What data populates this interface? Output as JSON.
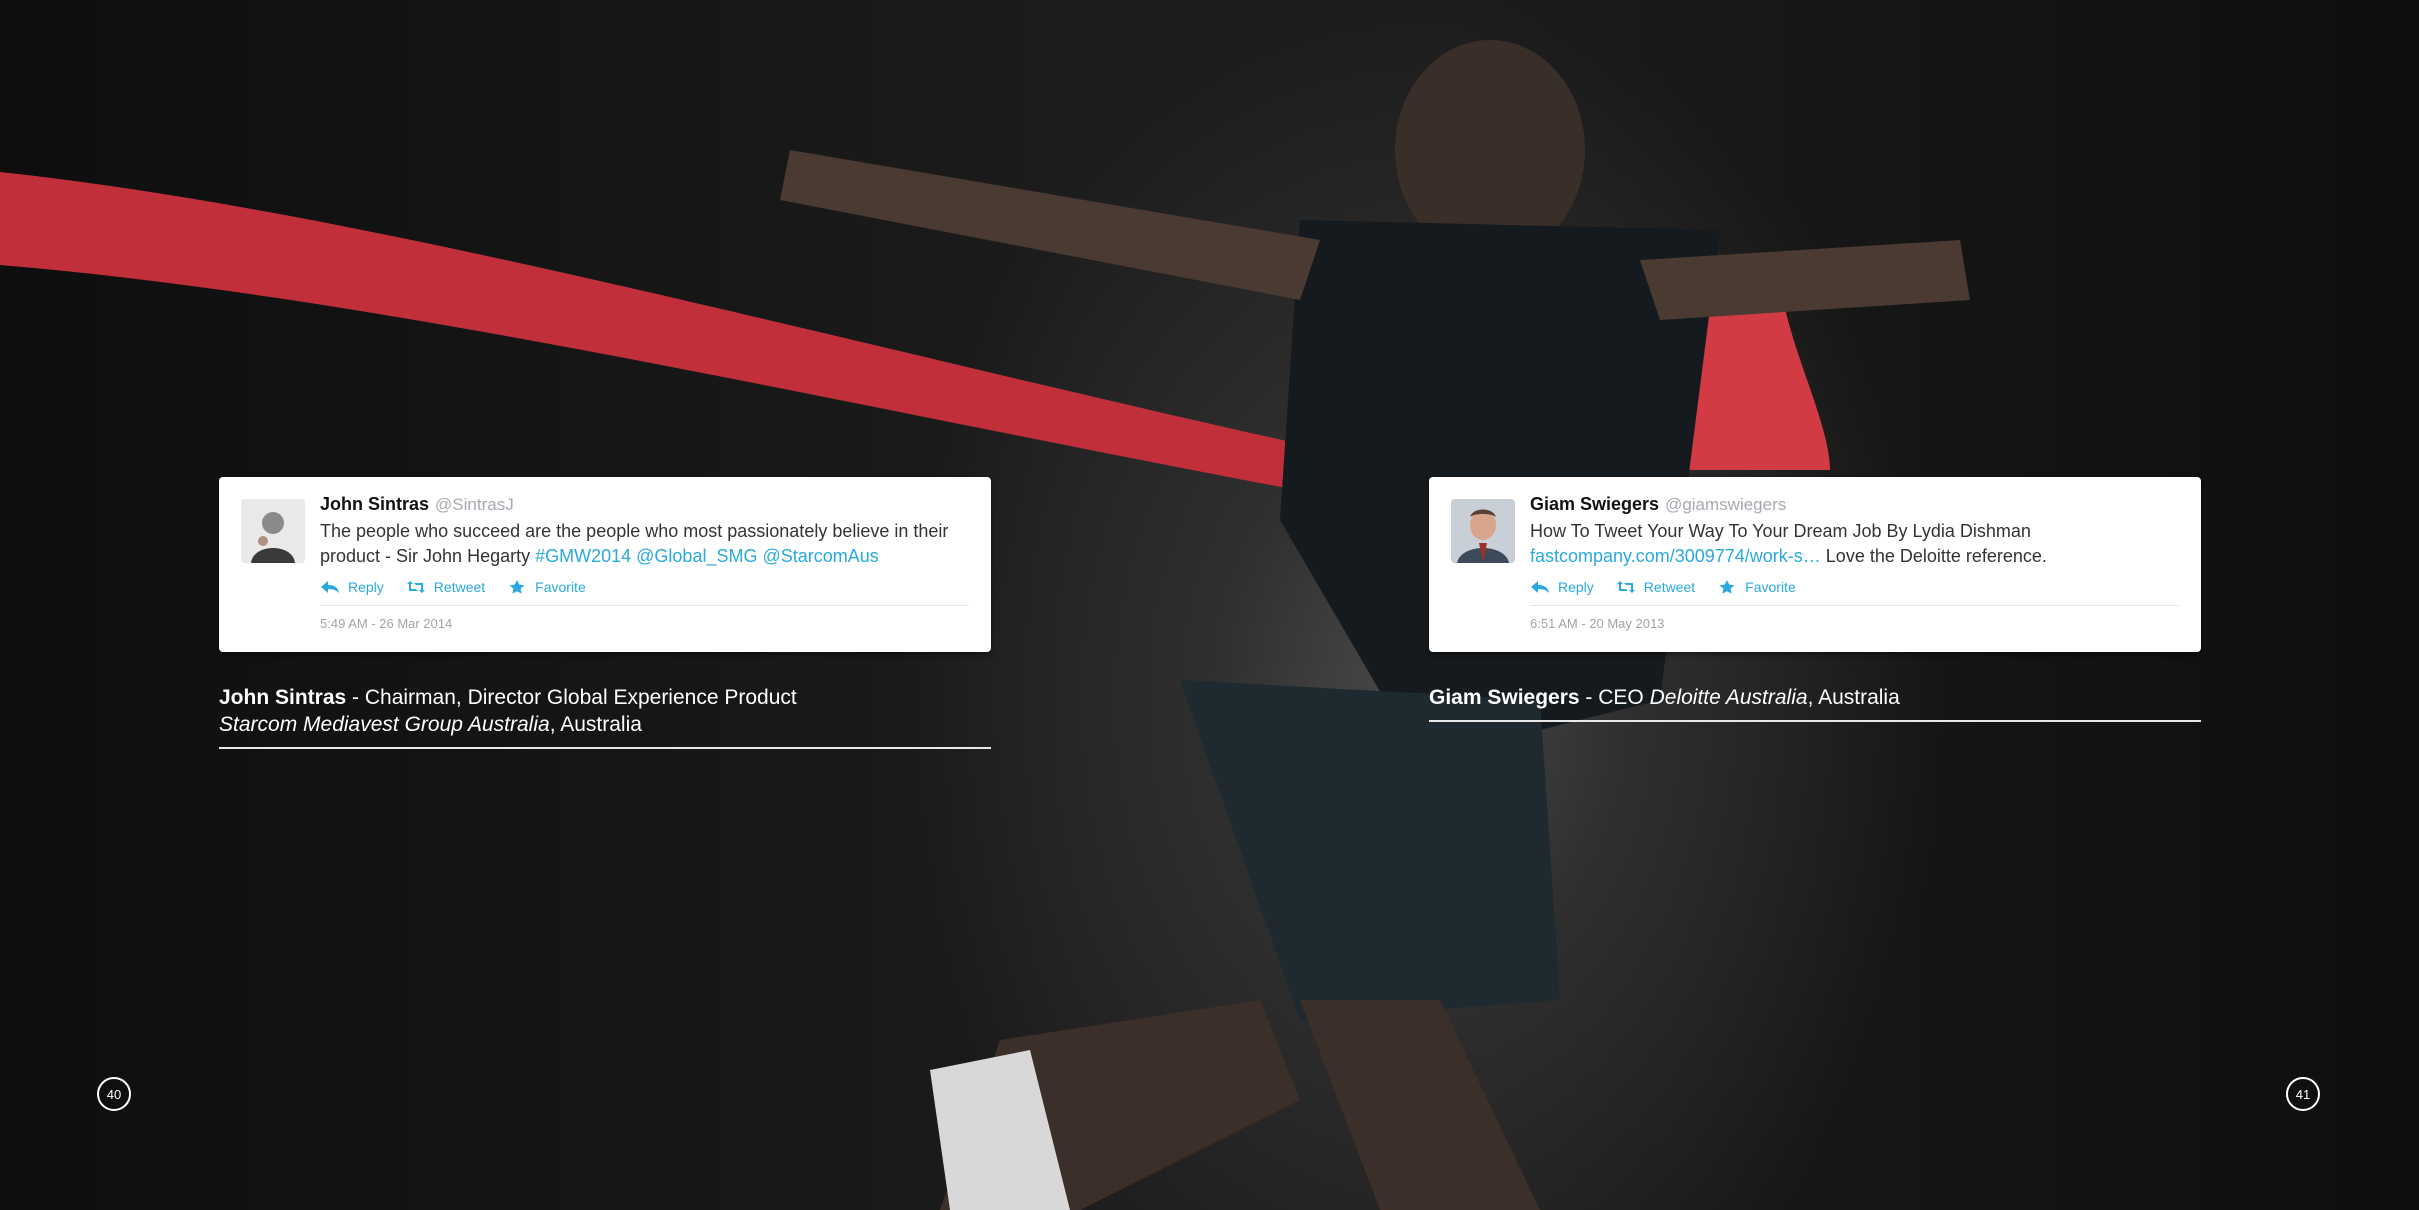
{
  "left": {
    "tweet": {
      "name": "John Sintras",
      "handle": "@SintrasJ",
      "text_plain": "The people who succeed are the people who most passionately believe in their product - Sir John Hegarty ",
      "text_links": "#GMW2014 @Global_SMG @StarcomAus",
      "reply": "Reply",
      "retweet": "Retweet",
      "favorite": "Favorite",
      "time": "5:49 AM - 26 Mar 2014"
    },
    "caption": {
      "name": "John Sintras",
      "role": " - Chairman, Director Global Experience Product",
      "company": "Starcom Mediavest Group Australia",
      "country": ", Australia"
    },
    "page": "40"
  },
  "right": {
    "tweet": {
      "name": "Giam Swiegers",
      "handle": "@giamswiegers",
      "text_line1": "How To Tweet Your Way To Your Dream Job By Lydia Dishman",
      "link": "fastcompany.com/3009774/work-s…",
      "text_after_link": " Love the Deloitte reference.",
      "reply": "Reply",
      "retweet": "Retweet",
      "favorite": "Favorite",
      "time": "6:51 AM - 20 May 2013"
    },
    "caption": {
      "name": "Giam Swiegers",
      "role_pre": " - CEO ",
      "company": "Deloitte Australia",
      "country": ", Australia"
    },
    "page": "41"
  },
  "colors": {
    "link": "#2aa9e0",
    "ribbon": "#c9313a",
    "text_dark": "#333333"
  }
}
